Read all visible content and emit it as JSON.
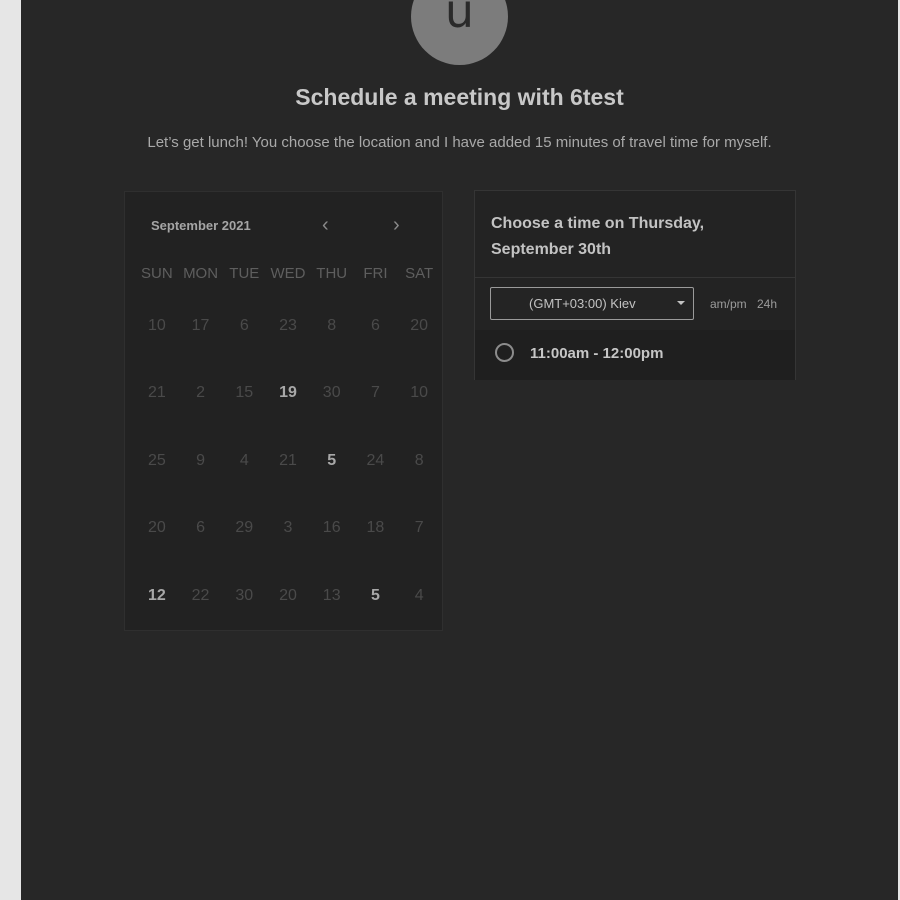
{
  "header": {
    "avatar_letter": "u",
    "title": "Schedule a meeting with 6test",
    "description": "Let’s get lunch! You choose the location and I have added 15 minutes of travel time for myself."
  },
  "calendar": {
    "month_label": "September 2021",
    "prev_icon": "chevron-left-icon",
    "next_icon": "chevron-right-icon",
    "weekdays": [
      "SUN",
      "MON",
      "TUE",
      "WED",
      "THU",
      "FRI",
      "SAT"
    ],
    "weeks": [
      [
        "10",
        "17",
        "6",
        "23",
        "8",
        "6",
        "20"
      ],
      [
        "21",
        "2",
        "15",
        "19",
        "30",
        "7",
        "10"
      ],
      [
        "25",
        "9",
        "4",
        "21",
        "5",
        "24",
        "8"
      ],
      [
        "20",
        "6",
        "29",
        "3",
        "16",
        "18",
        "7"
      ],
      [
        "12",
        "22",
        "30",
        "20",
        "13",
        "5",
        "4"
      ]
    ],
    "active_days": [
      [
        1,
        3
      ],
      [
        2,
        4
      ],
      [
        4,
        0
      ],
      [
        4,
        5
      ]
    ]
  },
  "time_panel": {
    "heading": "Choose a time on Thursday, September 30th",
    "timezone": "(GMT+03:00) Kiev",
    "format_ampm": "am/pm",
    "format_24h": "24h",
    "slots": [
      {
        "label": "11:00am - 12:00pm"
      }
    ]
  }
}
